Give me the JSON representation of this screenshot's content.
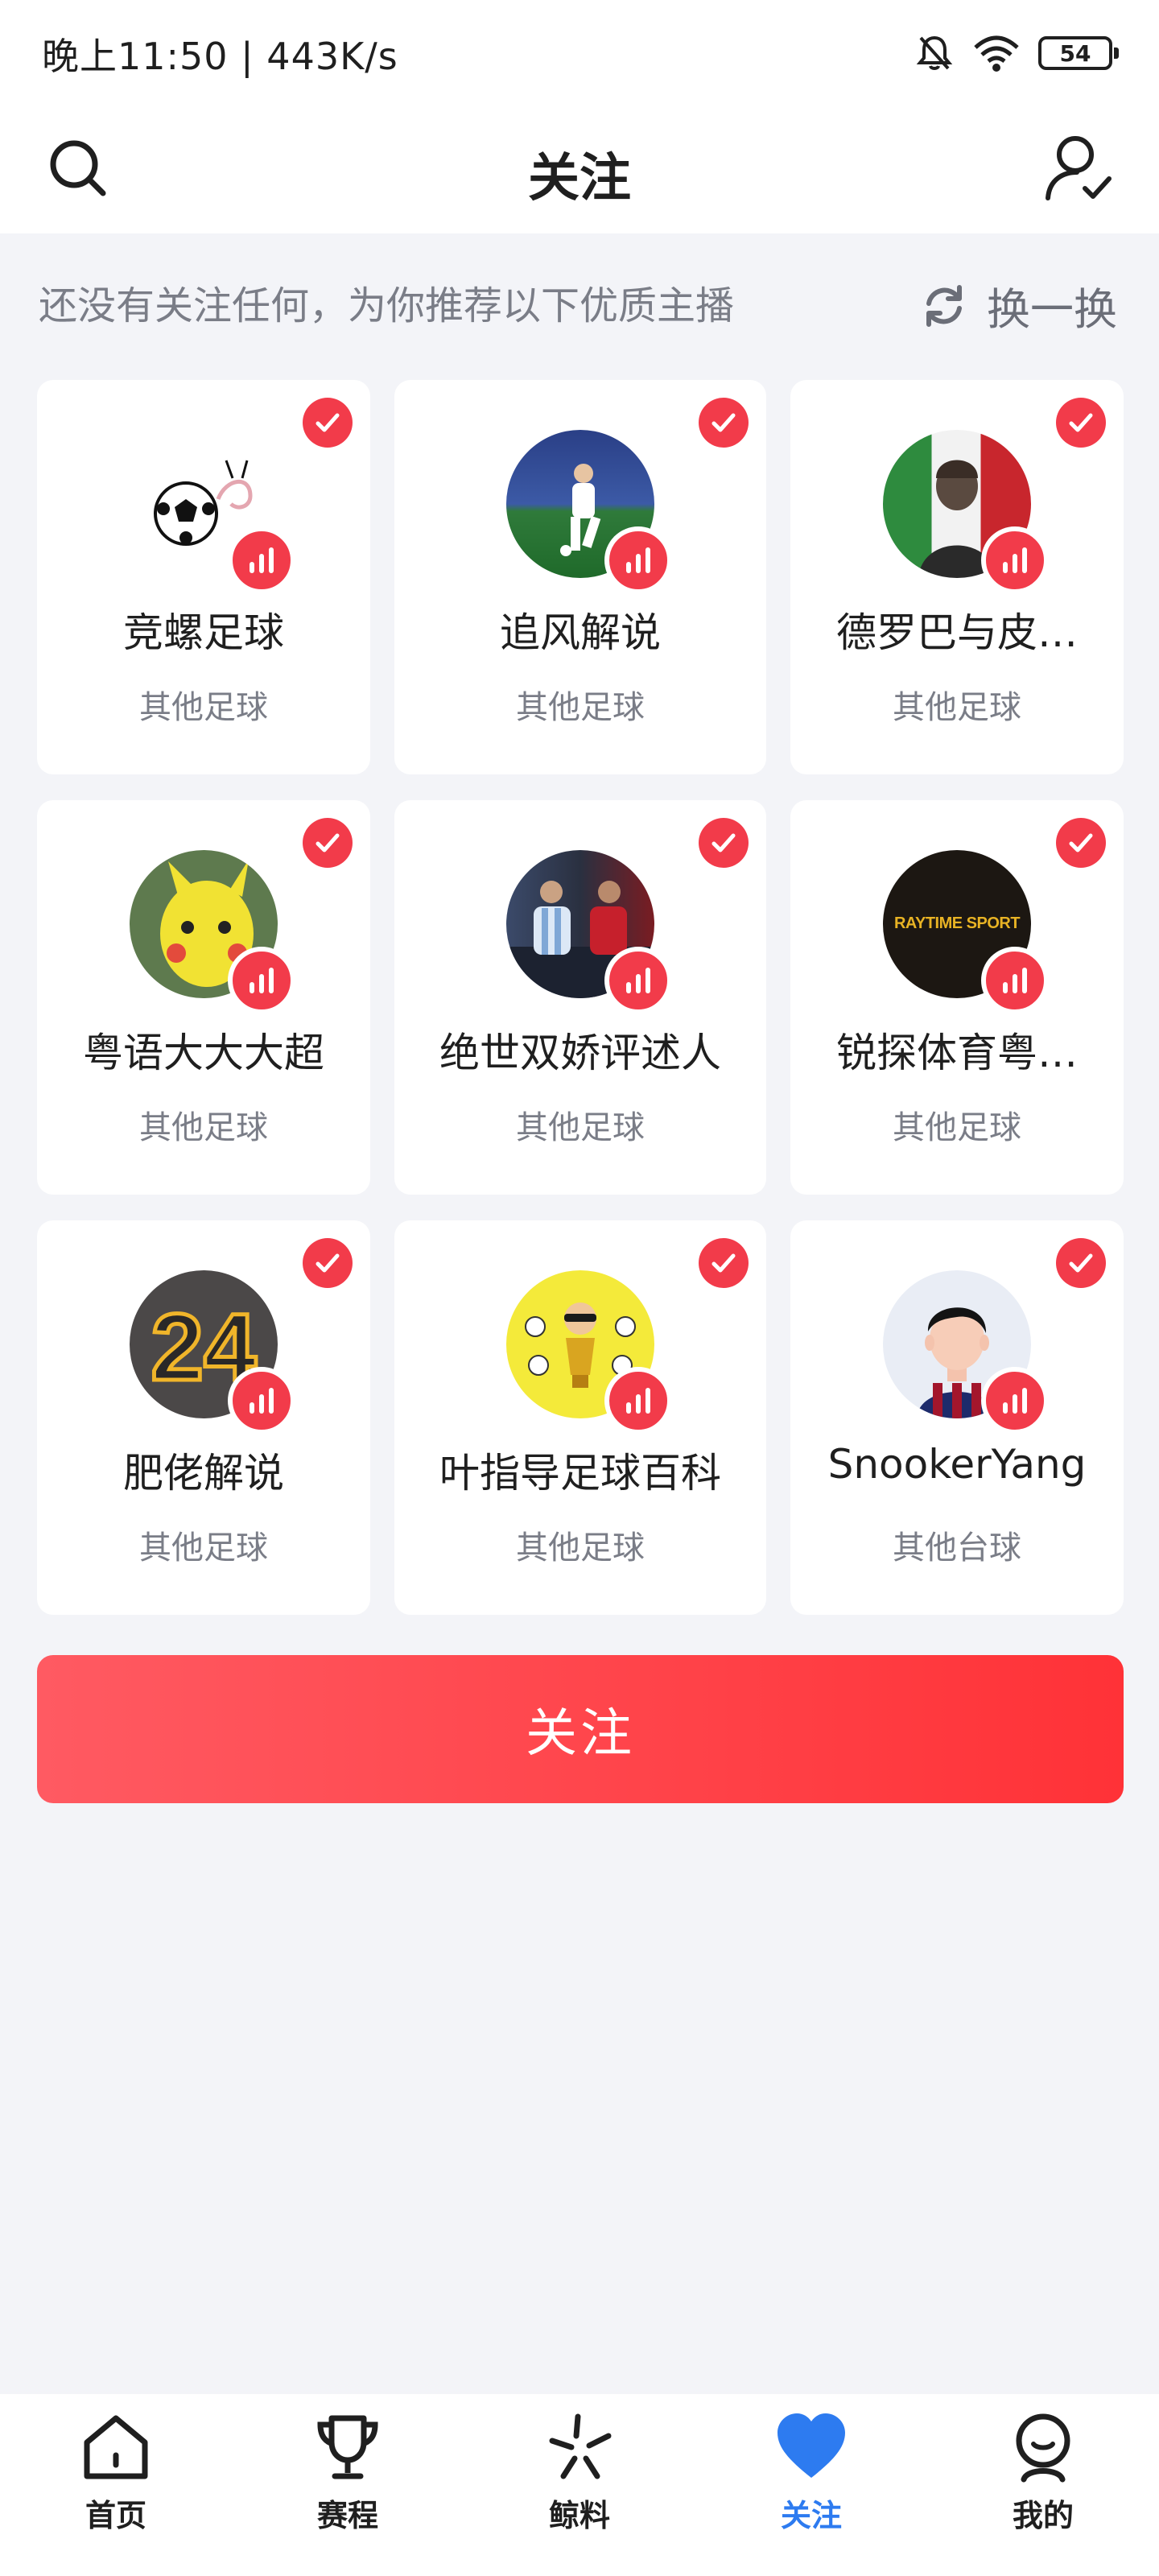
{
  "status_bar": {
    "time_speed": "晚上11:50 | 443K/s",
    "battery": "54"
  },
  "header": {
    "title": "关注"
  },
  "recommend": {
    "text": "还没有关注任何，为你推荐以下优质主播",
    "refresh_label": "换一换"
  },
  "cards": [
    {
      "name": "竞螺足球",
      "category": "其他足球"
    },
    {
      "name": "追风解说",
      "category": "其他足球"
    },
    {
      "name": "德罗巴与皮…",
      "category": "其他足球"
    },
    {
      "name": "粤语大大大超",
      "category": "其他足球"
    },
    {
      "name": "绝世双娇评述人",
      "category": "其他足球"
    },
    {
      "name": "锐探体育粤…",
      "category": "其他足球"
    },
    {
      "name": "肥佬解说",
      "category": "其他足球"
    },
    {
      "name": "叶指导足球百科",
      "category": "其他足球"
    },
    {
      "name": "SnookerYang",
      "category": "其他台球"
    }
  ],
  "avatar_texts": {
    "raytime": "RAYTIME SPORT",
    "number": "24"
  },
  "follow_button": {
    "label": "关注"
  },
  "bottom_nav": [
    {
      "label": "首页",
      "icon": "home-icon"
    },
    {
      "label": "赛程",
      "icon": "trophy-icon"
    },
    {
      "label": "鲸料",
      "icon": "sparkle-icon"
    },
    {
      "label": "关注",
      "icon": "heart-icon",
      "active": true
    },
    {
      "label": "我的",
      "icon": "profile-icon"
    }
  ],
  "colors": {
    "accent": "#f23b4a",
    "nav_active": "#2d7bf0",
    "background": "#f3f4f8"
  }
}
